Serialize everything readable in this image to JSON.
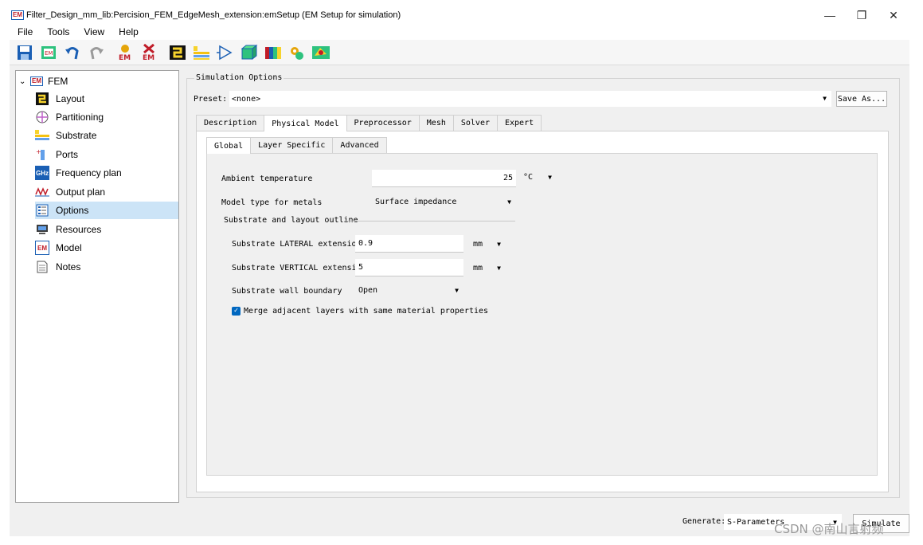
{
  "window": {
    "title": "Filter_Design_mm_lib:Percision_FEM_EdgeMesh_extension:emSetup (EM Setup for simulation)",
    "logo_text": "EM",
    "minimize": "—",
    "restore": "❐",
    "close": "✕"
  },
  "menu": [
    "File",
    "Tools",
    "View",
    "Help"
  ],
  "toolbar_icons": [
    "save-icon",
    "em-window-icon",
    "undo-icon",
    "redo-icon",
    "em-settings-icon",
    "em-delete-icon",
    "layout-icon",
    "substrate-icon",
    "port-triangle-icon",
    "box-3d-icon",
    "color-blocks-icon",
    "gear-stack-icon",
    "mesh-map-icon"
  ],
  "tree": {
    "root": "FEM",
    "root_icon_text": "EM",
    "items": [
      {
        "label": "Layout",
        "icon": "layout-icon"
      },
      {
        "label": "Partitioning",
        "icon": "partitioning-icon"
      },
      {
        "label": "Substrate",
        "icon": "substrate-icon"
      },
      {
        "label": "Ports",
        "icon": "ports-icon"
      },
      {
        "label": "Frequency plan",
        "icon": "frequency-icon",
        "icon_text": "GHz"
      },
      {
        "label": "Output plan",
        "icon": "output-plan-icon"
      },
      {
        "label": "Options",
        "icon": "options-icon",
        "selected": true
      },
      {
        "label": "Resources",
        "icon": "resources-icon"
      },
      {
        "label": "Model",
        "icon": "model-icon",
        "icon_text": "EM"
      },
      {
        "label": "Notes",
        "icon": "notes-icon"
      }
    ]
  },
  "options": {
    "group_title": "Simulation Options",
    "preset_label": "Preset:",
    "preset_value": "<none>",
    "save_as": "Save As...",
    "tabs": [
      "Description",
      "Physical Model",
      "Preprocessor",
      "Mesh",
      "Solver",
      "Expert"
    ],
    "subtabs": [
      "Global",
      "Layer Specific",
      "Advanced"
    ],
    "ambient_label": "Ambient temperature",
    "ambient_value": "25",
    "ambient_unit": "°C",
    "metal_label": "Model type for metals",
    "metal_value": "Surface impedance",
    "outline_title": "Substrate and layout outline",
    "lateral_label": "Substrate LATERAL extension",
    "lateral_value": "0.9",
    "lateral_unit": "mm",
    "vertical_label": "Substrate VERTICAL extension",
    "vertical_value": "5",
    "vertical_unit": "mm",
    "wall_label": "Substrate wall boundary",
    "wall_value": "Open",
    "merge_label": "Merge adjacent layers with same material properties",
    "merge_checked": true
  },
  "footer": {
    "generate_label": "Generate:",
    "generate_value": "S-Parameters",
    "simulate": "Simulate"
  },
  "watermark": "CSDN @南山言射频"
}
